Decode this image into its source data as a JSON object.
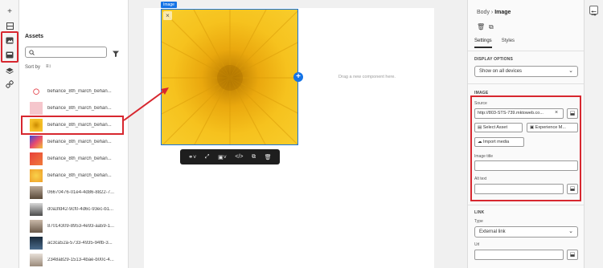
{
  "rail": {
    "add_icon": "plus-icon",
    "items": [
      "layout-icon",
      "assets-icon",
      "content-icon",
      "layers-icon",
      "link-icon"
    ]
  },
  "assets_panel": {
    "title": "Assets",
    "search_placeholder": "",
    "sort_label": "Sort by",
    "items": [
      {
        "label": "behance_8th_march_behan...",
        "thumb": "logo",
        "color": "#ffffff"
      },
      {
        "label": "behance_8th_march_behan...",
        "thumb": "pink",
        "color": "#f5c6cc"
      },
      {
        "label": "behance_8th_march_behan...",
        "thumb": "yellow-flower",
        "color": "#e9a915"
      },
      {
        "label": "behance_8th_march_behan...",
        "thumb": "colorful",
        "color": "#e94a6e"
      },
      {
        "label": "behance_8th_march_behan...",
        "thumb": "red",
        "color": "#e8413a"
      },
      {
        "label": "behance_8th_march_behan...",
        "thumb": "orange",
        "color": "#f0a02a"
      },
      {
        "label": "06670476-01e4-4d86-8822-7...",
        "thumb": "photo",
        "color": "#7a6a5a"
      },
      {
        "label": "d0a3fd42-9cf0-4d6c-93ec-b1...",
        "thumb": "photo",
        "color": "#5a5a5a"
      },
      {
        "label": "87014309-8953-4e93-aa59-1...",
        "thumb": "photo",
        "color": "#8a7a6a"
      },
      {
        "label": "ac3ca52a-5733-4935-94fb-3...",
        "thumb": "photo",
        "color": "#2a3a4a"
      },
      {
        "label": "2348a829-1513-4bae-b00c-4...",
        "thumb": "photo",
        "color": "#9a8a7a"
      }
    ]
  },
  "canvas": {
    "image_tag": "Image",
    "drop_hint": "Drag a new component here.",
    "toolbar": [
      "link-icon",
      "unlink-icon",
      "image-icon",
      "code-icon",
      "duplicate-icon",
      "delete-icon"
    ]
  },
  "properties": {
    "breadcrumb_parent": "Body",
    "breadcrumb_sep": "›",
    "breadcrumb_current": "Image",
    "tabs": [
      "Settings",
      "Styles"
    ],
    "display_options": {
      "heading": "DISPLAY OPTIONS",
      "value": "Show on all devices"
    },
    "image": {
      "heading": "IMAGE",
      "source_label": "Source",
      "source_value": "http://803-STS-739.mktoweb.co...",
      "select_asset": "Select Asset",
      "experience_manager": "Experience M...",
      "import_media": "Import media",
      "title_label": "Image title",
      "title_value": "",
      "alt_label": "Alt text",
      "alt_value": ""
    },
    "link": {
      "heading": "LINK",
      "type_label": "Type",
      "type_value": "External link",
      "url_label": "Url",
      "url_value": ""
    }
  },
  "colors": {
    "accent": "#1473e6",
    "highlight": "#d7272f"
  }
}
